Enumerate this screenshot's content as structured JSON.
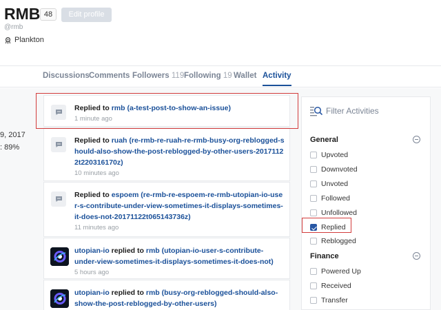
{
  "profile": {
    "name": "RMB",
    "reputation": "48",
    "edit_label": "Edit profile",
    "handle": "@rmb",
    "rank": "Plankton"
  },
  "nav": {
    "tabs": [
      {
        "label": "Discussions",
        "count": ""
      },
      {
        "label": "Comments",
        "count": ""
      },
      {
        "label": "Followers",
        "count": "119"
      },
      {
        "label": "Following",
        "count": "19"
      },
      {
        "label": "Wallet",
        "count": ""
      },
      {
        "label": "Activity",
        "count": ""
      }
    ],
    "active": "Activity"
  },
  "sidebar": {
    "date_fragment": "9, 2017",
    "percent_fragment": ": 89%"
  },
  "activities": [
    {
      "actor": "",
      "verb": "Replied to",
      "target": "rmb",
      "permlink": "(a-test-post-to-show-an-issue)",
      "time": "1 minute ago",
      "icon": "comment-icon"
    },
    {
      "actor": "",
      "verb": "Replied to",
      "target": "ruah",
      "permlink": "(re-rmb-re-ruah-re-rmb-busy-org-reblogged-should-also-show-the-post-reblogged-by-other-users-20171122t220316170z)",
      "time": "10 minutes ago",
      "icon": "comment-icon"
    },
    {
      "actor": "",
      "verb": "Replied to",
      "target": "espoem",
      "permlink": "(re-rmb-re-espoem-re-rmb-utopian-io-user-s-contribute-under-view-sometimes-it-displays-sometimes-it-does-not-20171122t065143736z)",
      "time": "11 minutes ago",
      "icon": "comment-icon"
    },
    {
      "actor": "utopian-io",
      "verb": "replied to",
      "target": "rmb",
      "permlink": "(utopian-io-user-s-contribute-under-view-sometimes-it-displays-sometimes-it-does-not)",
      "time": "5 hours ago",
      "icon": "utopian-avatar"
    },
    {
      "actor": "utopian-io",
      "verb": "replied to",
      "target": "rmb",
      "permlink": "(busy-org-reblogged-should-also-show-the-post-reblogged-by-other-users)",
      "time": "",
      "icon": "utopian-avatar"
    }
  ],
  "filter": {
    "title": "Filter Activities",
    "general_title": "General",
    "general_options": [
      {
        "label": "Upvoted",
        "checked": false
      },
      {
        "label": "Downvoted",
        "checked": false
      },
      {
        "label": "Unvoted",
        "checked": false
      },
      {
        "label": "Followed",
        "checked": false
      },
      {
        "label": "Unfollowed",
        "checked": false
      },
      {
        "label": "Replied",
        "checked": true
      },
      {
        "label": "Reblogged",
        "checked": false
      }
    ],
    "finance_title": "Finance",
    "finance_options": [
      {
        "label": "Powered Up",
        "checked": false
      },
      {
        "label": "Received",
        "checked": false
      },
      {
        "label": "Transfer",
        "checked": false
      }
    ]
  },
  "colors": {
    "accent": "#1a5099",
    "highlight": "#d23b3b",
    "checkbox": "#2857a4"
  }
}
